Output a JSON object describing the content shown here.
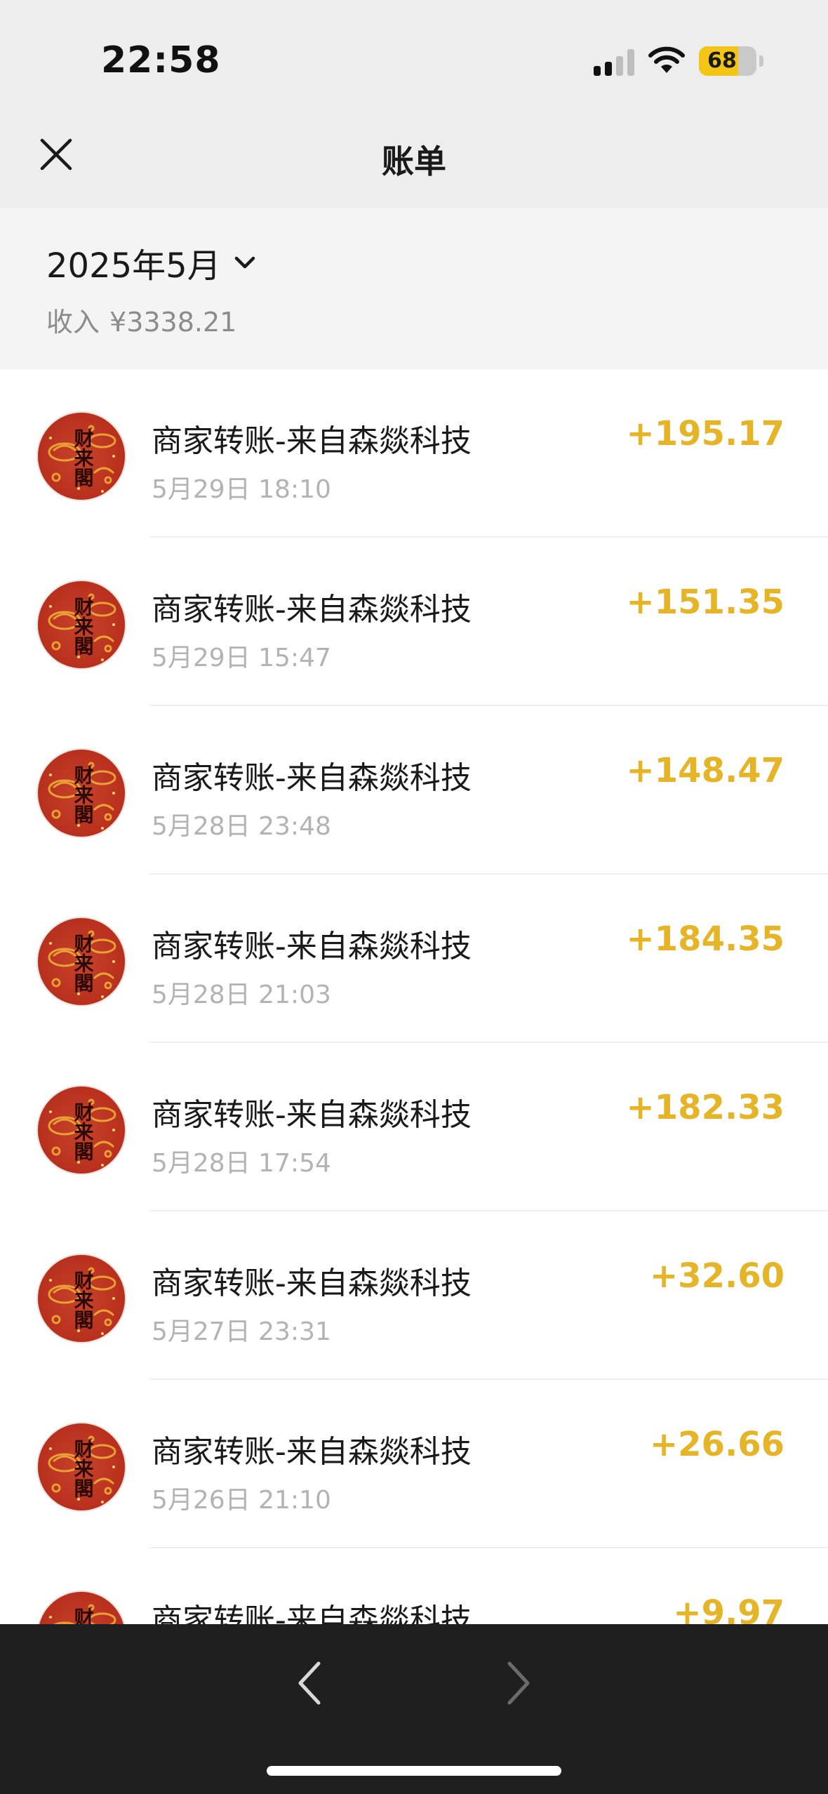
{
  "status_bar": {
    "time": "22:58",
    "battery": "68",
    "icons": [
      "signal-icon",
      "wifi-icon",
      "battery-icon"
    ]
  },
  "nav": {
    "title": "账单",
    "close_icon": "close-icon"
  },
  "month_header": {
    "month": "2025年5月",
    "income_label": "收入",
    "income_value": "¥3338.21"
  },
  "transactions": [
    {
      "title": "商家转账-来自森燚科技",
      "time": "5月29日 18:10",
      "amount": "+195.17"
    },
    {
      "title": "商家转账-来自森燚科技",
      "time": "5月29日 15:47",
      "amount": "+151.35"
    },
    {
      "title": "商家转账-来自森燚科技",
      "time": "5月28日 23:48",
      "amount": "+148.47"
    },
    {
      "title": "商家转账-来自森燚科技",
      "time": "5月28日 21:03",
      "amount": "+184.35"
    },
    {
      "title": "商家转账-来自森燚科技",
      "time": "5月28日 17:54",
      "amount": "+182.33"
    },
    {
      "title": "商家转账-来自森燚科技",
      "time": "5月27日 23:31",
      "amount": "+32.60"
    },
    {
      "title": "商家转账-来自森燚科技",
      "time": "5月26日 21:10",
      "amount": "+26.66"
    },
    {
      "title": "商家转账-来自森燚科技",
      "time": "",
      "amount": "+9.97"
    }
  ],
  "avatar_text": "财来閣",
  "colors": {
    "amount": "#e5b527",
    "avatar_red": "#b8301d",
    "battery_yellow": "#f3c515",
    "toolbar_bg": "#1f1f1f"
  },
  "toolbar": {
    "back_icon": "chevron-left-icon",
    "forward_icon": "chevron-right-icon"
  }
}
